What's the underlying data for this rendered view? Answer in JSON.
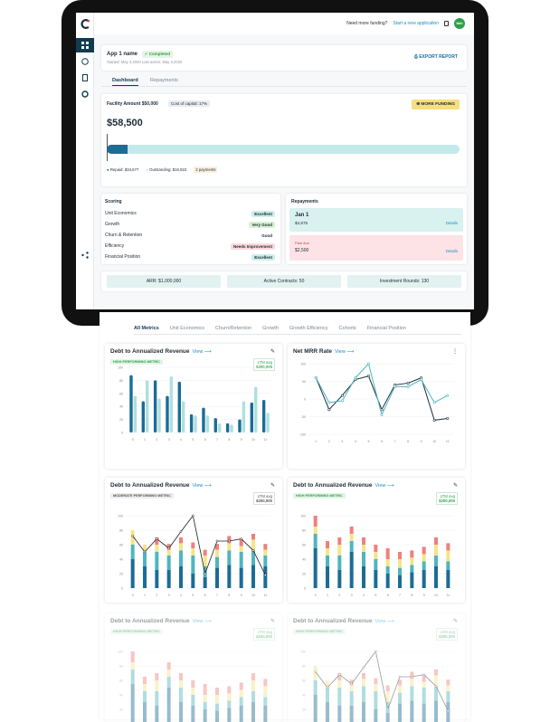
{
  "topbar": {
    "funding_q": "Need more funding?",
    "start_link": "Start a new application",
    "avatar": "Mah"
  },
  "app": {
    "name": "App 1 name",
    "status": "Completed",
    "meta": "Started: May 3,2020  Last action: May 3,2020",
    "export": "EXPORT REPORT"
  },
  "tabs": [
    "Dashboard",
    "Repayments"
  ],
  "facility": {
    "label": "Facility Amount $50,000",
    "cost": "Cost of capital: 17%",
    "amount": "$58,500",
    "more": "MORE FUNDING",
    "repaid": "Repaid: $34,677",
    "outstanding": "Outstanding: $16,823",
    "payments": "2 payments",
    "repaid_fraction": 0.06
  },
  "scoring": {
    "title": "Scoring",
    "rows": [
      {
        "label": "Unit Economics",
        "value": "Excellent",
        "color": "#cdeee9"
      },
      {
        "label": "Growth",
        "value": "Very Good",
        "color": "#d6f3d0"
      },
      {
        "label": "Churn & Retention",
        "value": "Good",
        "color": "#ffffff"
      },
      {
        "label": "Efficiency",
        "value": "Needs Improvement",
        "color": "#fbd9dc"
      },
      {
        "label": "Financial Position",
        "value": "Excellent",
        "color": "#cdeee9"
      }
    ]
  },
  "repayments": {
    "title": "Repayments",
    "items": [
      {
        "date": "Jan 1",
        "amount": "$4,875",
        "link": "Details",
        "due": ""
      },
      {
        "date": "Past due",
        "amount": "$2,500",
        "link": "Details",
        "due": "yes"
      }
    ]
  },
  "stats": [
    "ARR: $1,000,000",
    "Active Contracts: 50",
    "Investment Rounds: 130"
  ],
  "metric_tabs": [
    "All Metrics",
    "Unit Economics",
    "Churn/Retention",
    "Growth",
    "Growth Efficiency",
    "Cohorts",
    "Financial Position"
  ],
  "panels": [
    {
      "title": "Debt to Annualized Revenue",
      "view": "View",
      "badge": "HIGH PERFORMING METRIC",
      "ltm1": "LTM avg",
      "ltm2": "$200,000"
    },
    {
      "title": "Net MRR Rate",
      "view": "View"
    },
    {
      "title": "Debt to Annualized Revenue",
      "view": "View",
      "badge": "MODERATE PERFORMING METRIC",
      "ltm1": "LTM avg",
      "ltm2": "$200,000"
    },
    {
      "title": "Debt to Annualized Revenue",
      "view": "View",
      "badge": "HIGH PERFORMING METRIC",
      "ltm1": "LTM avg",
      "ltm2": "$200,000"
    },
    {
      "title": "Debt to Annualized Revenue",
      "view": "View",
      "badge": "HIGH PERFORMING METRIC",
      "ltm1": "LTM avg",
      "ltm2": "$200,000"
    },
    {
      "title": "Debt to Annualized Revenue",
      "view": "View",
      "badge": "HIGH PERFORMING METRIC",
      "ltm1": "LTM avg",
      "ltm2": "$200,000"
    }
  ],
  "chart_data": [
    {
      "type": "bar",
      "x": [
        "0",
        "1",
        "2",
        "3",
        "4",
        "5",
        "6",
        "7",
        "8",
        "9",
        "10",
        "11"
      ],
      "yticks": [
        "0",
        "20",
        "40",
        "60",
        "80",
        "100"
      ],
      "series": [
        {
          "values": [
            88,
            48,
            80,
            56,
            78,
            28,
            38,
            22,
            14,
            20,
            46,
            50
          ],
          "color": "#1c6c95"
        },
        {
          "values": [
            56,
            80,
            52,
            86,
            48,
            26,
            26,
            14,
            12,
            48,
            70,
            30
          ],
          "color": "#aee0de"
        }
      ]
    },
    {
      "type": "line",
      "x": [
        "1",
        "2",
        "3",
        "4",
        "5",
        "6",
        "7",
        "8",
        "9",
        "10",
        "11"
      ],
      "yticks": [
        "-100",
        "-50",
        "0",
        "50",
        "100"
      ],
      "series": [
        {
          "values": [
            60,
            -30,
            10,
            55,
            65,
            -30,
            40,
            45,
            60,
            -60,
            -55
          ],
          "color": "#1c3040"
        },
        {
          "values": [
            60,
            -10,
            -5,
            60,
            100,
            -45,
            35,
            35,
            55,
            -10,
            10
          ],
          "color": "#4fb5bf"
        }
      ]
    },
    {
      "type": "stacked",
      "x": [
        "0",
        "1",
        "2",
        "3",
        "4",
        "5",
        "6",
        "7",
        "8",
        "9",
        "10",
        "11"
      ],
      "yticks": [
        "0",
        "20",
        "40",
        "60",
        "80",
        "100"
      ],
      "series": [
        {
          "values": [
            40,
            30,
            25,
            25,
            30,
            20,
            15,
            28,
            32,
            28,
            32,
            30
          ],
          "color": "#1c6c95"
        },
        {
          "values": [
            20,
            20,
            25,
            20,
            22,
            25,
            15,
            15,
            20,
            22,
            20,
            15
          ],
          "color": "#4fb5bf"
        },
        {
          "values": [
            20,
            10,
            10,
            8,
            10,
            10,
            15,
            10,
            10,
            8,
            15,
            8
          ],
          "color": "#f4e48a"
        },
        {
          "values": [
            0,
            0,
            10,
            8,
            8,
            8,
            8,
            8,
            10,
            10,
            8,
            8
          ],
          "color": "#f07f7f"
        }
      ],
      "line": [
        72,
        50,
        68,
        55,
        78,
        100,
        20,
        65,
        65,
        68,
        52,
        18
      ]
    },
    {
      "type": "stacked",
      "x": [
        "0",
        "1",
        "2",
        "3",
        "4",
        "5",
        "6",
        "7",
        "8",
        "9",
        "10",
        "11"
      ],
      "yticks": [
        "0",
        "20",
        "40",
        "60",
        "80",
        "100"
      ],
      "series": [
        {
          "values": [
            55,
            30,
            25,
            50,
            30,
            25,
            20,
            18,
            22,
            25,
            30,
            25
          ],
          "color": "#1c6c95"
        },
        {
          "values": [
            20,
            15,
            20,
            15,
            20,
            15,
            10,
            10,
            10,
            12,
            15,
            12
          ],
          "color": "#4fb5bf"
        },
        {
          "values": [
            10,
            10,
            15,
            10,
            10,
            10,
            10,
            12,
            10,
            10,
            15,
            15
          ],
          "color": "#f4e48a"
        },
        {
          "values": [
            15,
            10,
            10,
            10,
            10,
            10,
            15,
            10,
            10,
            10,
            10,
            10
          ],
          "color": "#f07f7f"
        }
      ]
    }
  ]
}
